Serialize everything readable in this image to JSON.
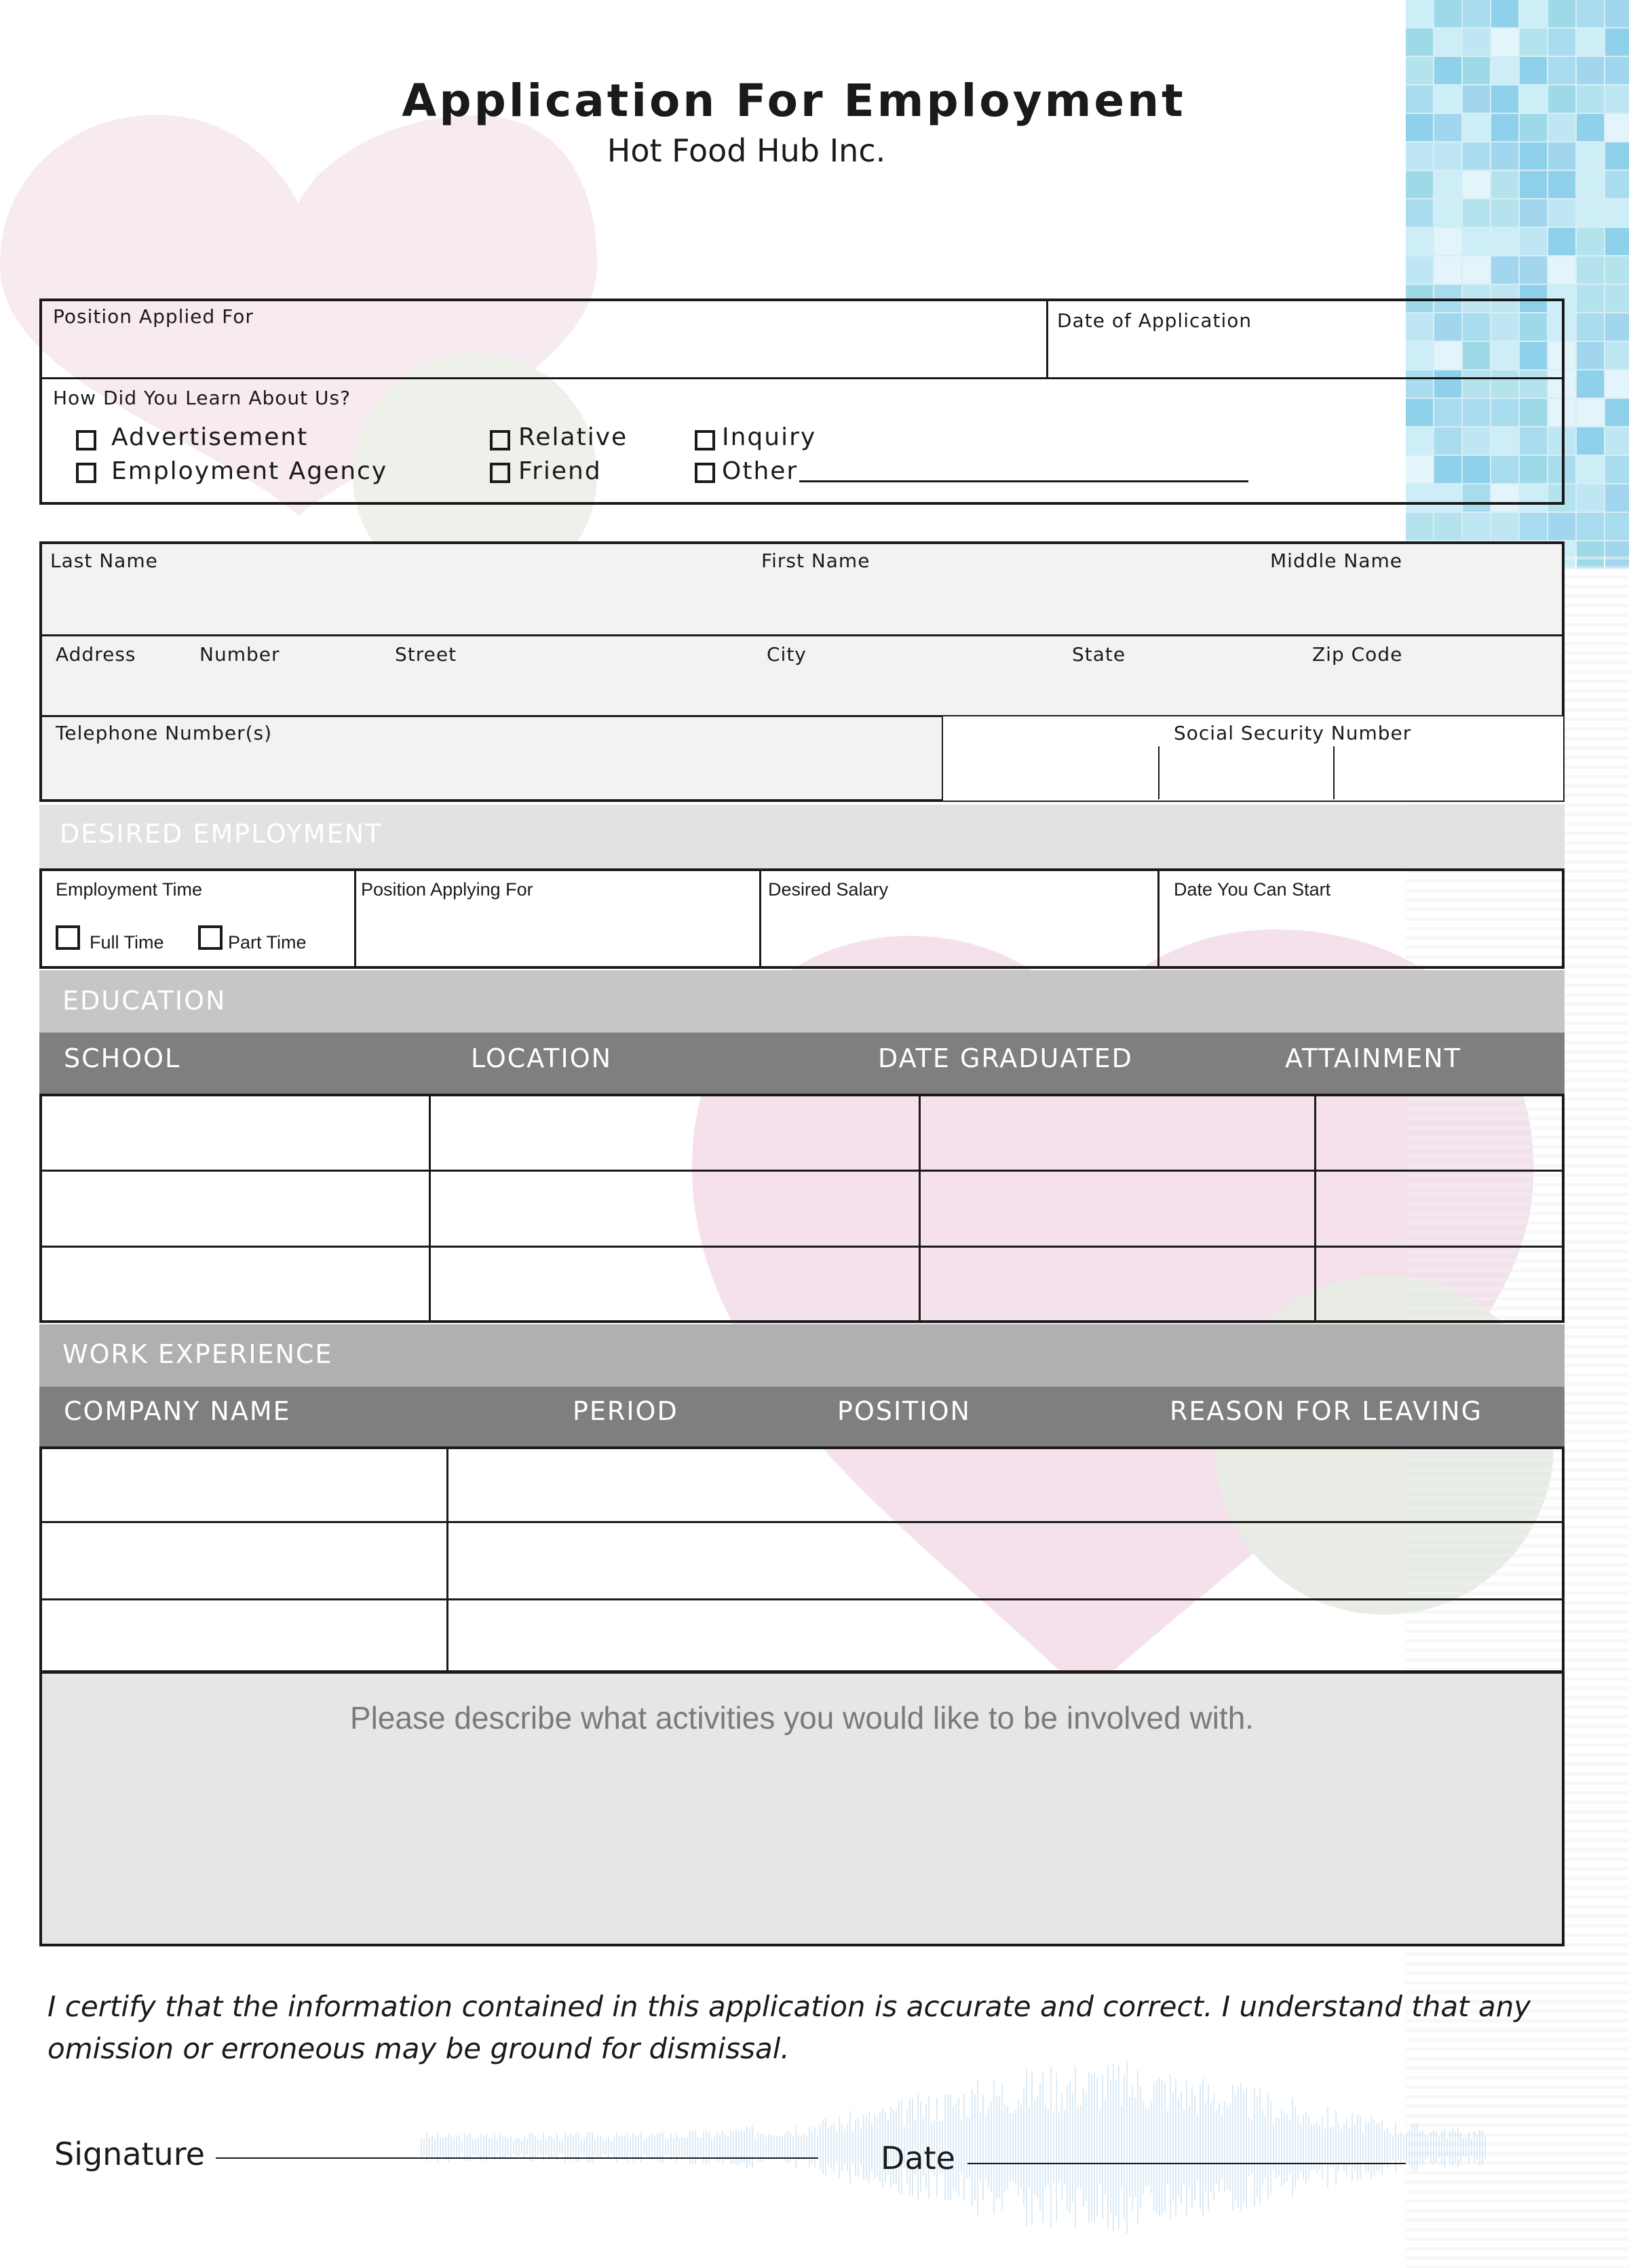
{
  "header": {
    "title": "Application For Employment",
    "company": "Hot Food Hub Inc."
  },
  "section1": {
    "position_applied_label": "Position Applied For",
    "date_of_application_label": "Date of Application",
    "learn_label": "How Did You Learn About Us?",
    "options": {
      "advertisement": "Advertisement",
      "employment_agency": "Employment Agency",
      "relative": "Relative",
      "friend": "Friend",
      "inquiry": "Inquiry",
      "other": "Other"
    }
  },
  "personal": {
    "last_name": "Last Name",
    "first_name": "First Name",
    "middle_name": "Middle Name",
    "address": "Address",
    "number": "Number",
    "street": "Street",
    "city": "City",
    "state": "State",
    "zip": "Zip Code",
    "telephone": "Telephone Number(s)",
    "ssn": "Social Security Number"
  },
  "desired": {
    "band": "DESIRED EMPLOYMENT",
    "employment_time": "Employment Time",
    "full_time": "Full Time",
    "part_time": "Part Time",
    "position_applying": "Position Applying For",
    "desired_salary": "Desired Salary",
    "date_start": "Date You Can Start"
  },
  "education": {
    "band": "EDUCATION",
    "columns": [
      "SCHOOL",
      "LOCATION",
      "DATE GRADUATED",
      "ATTAINMENT"
    ]
  },
  "work": {
    "band": "WORK EXPERIENCE",
    "columns": [
      "COMPANY NAME",
      "PERIOD",
      "POSITION",
      "REASON FOR LEAVING"
    ]
  },
  "describe": "Please describe what activities you would like to be involved with.",
  "certify": "I certify that the information contained in this application is accurate and correct. I understand that any omission or erroneous may be ground for dismissal.",
  "signature": {
    "signature_label": "Signature",
    "date_label": "Date"
  },
  "colors": {
    "band_light": "#e2e2e2",
    "band_medium": "#c6c6c6",
    "band_work": "#b0b0b0",
    "band_dark": "#7f7f7f",
    "heart": "#f4e1ec",
    "tile": "#9ad3ea"
  }
}
